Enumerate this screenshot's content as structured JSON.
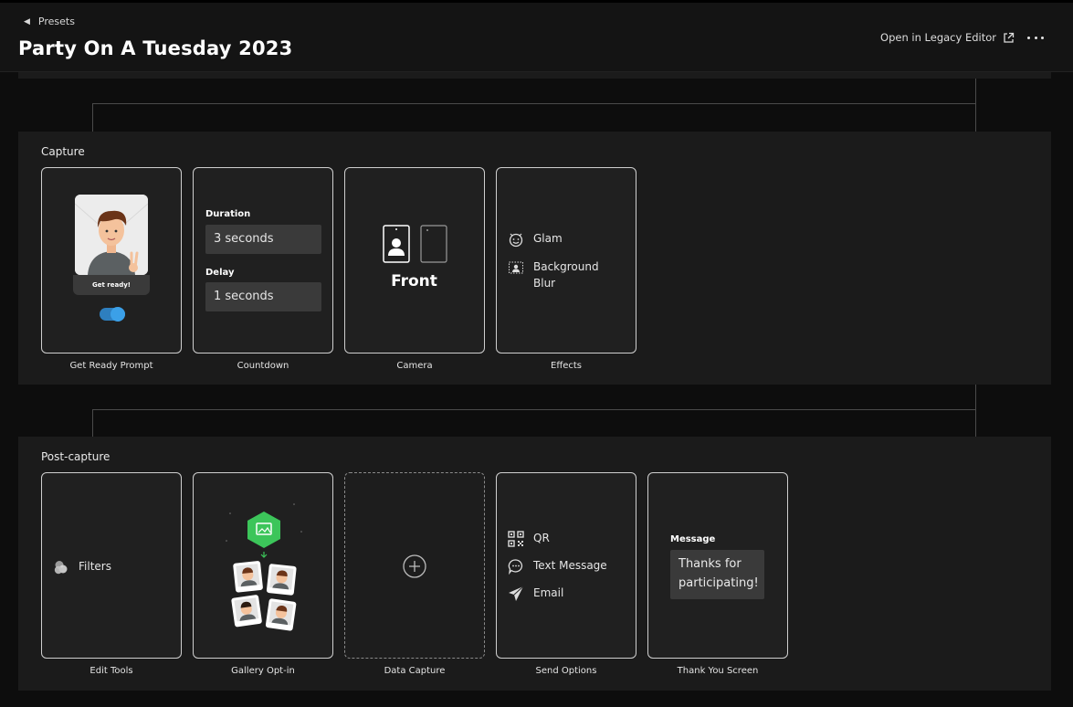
{
  "header": {
    "back_label": "Presets",
    "title": "Party On A Tuesday 2023",
    "legacy_label": "Open in Legacy Editor"
  },
  "capture": {
    "title": "Capture",
    "get_ready": {
      "caption": "Get ready!",
      "label": "Get Ready Prompt",
      "toggle_on": true
    },
    "countdown": {
      "label": "Countdown",
      "duration_label": "Duration",
      "duration_value": "3 seconds",
      "delay_label": "Delay",
      "delay_value": "1 seconds"
    },
    "camera": {
      "label": "Camera",
      "value": "Front"
    },
    "effects": {
      "label": "Effects",
      "items": [
        "Glam",
        "Background Blur"
      ]
    }
  },
  "post_capture": {
    "title": "Post-capture",
    "edit_tools": {
      "label": "Edit Tools",
      "item": "Filters"
    },
    "gallery": {
      "label": "Gallery Opt-in"
    },
    "data_capture": {
      "label": "Data Capture"
    },
    "send_options": {
      "label": "Send Options",
      "items": [
        "QR",
        "Text Message",
        "Email"
      ]
    },
    "thank_you": {
      "label": "Thank You Screen",
      "message_label": "Message",
      "message_value": "Thanks for participating!"
    }
  },
  "colors": {
    "background": "#0d0d0d",
    "panel": "#1b1b1b",
    "card": "#202020",
    "accent": "#3ba0e8",
    "gallery_badge": "#3cc55a"
  }
}
